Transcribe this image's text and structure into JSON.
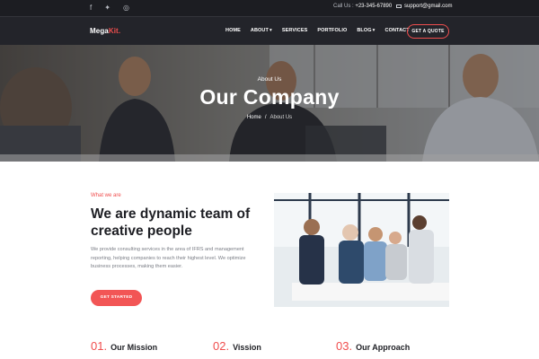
{
  "topbar": {
    "social": [
      {
        "icon": "facebook-icon",
        "glyph": "f"
      },
      {
        "icon": "twitter-icon",
        "glyph": "✦"
      },
      {
        "icon": "github-icon",
        "glyph": "◎"
      }
    ],
    "call_label": "Call Us :",
    "call_number": "+23-345-67890",
    "email": "support@gmail.com"
  },
  "nav": {
    "logo_main": "Mega",
    "logo_accent": "Kit.",
    "items": [
      {
        "label": "HOME",
        "active": false,
        "dropdown": false
      },
      {
        "label": "ABOUT",
        "active": true,
        "dropdown": true
      },
      {
        "label": "SERVICES",
        "active": false,
        "dropdown": false
      },
      {
        "label": "PORTFOLIO",
        "active": false,
        "dropdown": false
      },
      {
        "label": "BLOG",
        "active": false,
        "dropdown": true
      },
      {
        "label": "CONTACT",
        "active": false,
        "dropdown": false
      }
    ],
    "cta": "GET A QUOTE"
  },
  "hero": {
    "subtitle": "About Us",
    "title": "Our Company",
    "breadcrumb_home": "Home",
    "breadcrumb_sep": "/",
    "breadcrumb_current": "About Us"
  },
  "about": {
    "eyebrow": "What we are",
    "heading": "We are dynamic team of creative people",
    "paragraph": "We provide consulting services in the area of IFRS and management reporting, helping companies to reach their highest level. We optimize business processes, making them easier.",
    "button": "GET STARTED"
  },
  "features": [
    {
      "num": "01.",
      "label": "Our Mission"
    },
    {
      "num": "02.",
      "label": "Vission"
    },
    {
      "num": "03.",
      "label": "Our Approach"
    }
  ],
  "colors": {
    "accent": "#f04e4e",
    "dark": "#1c1d22",
    "nav": "#23242a"
  }
}
